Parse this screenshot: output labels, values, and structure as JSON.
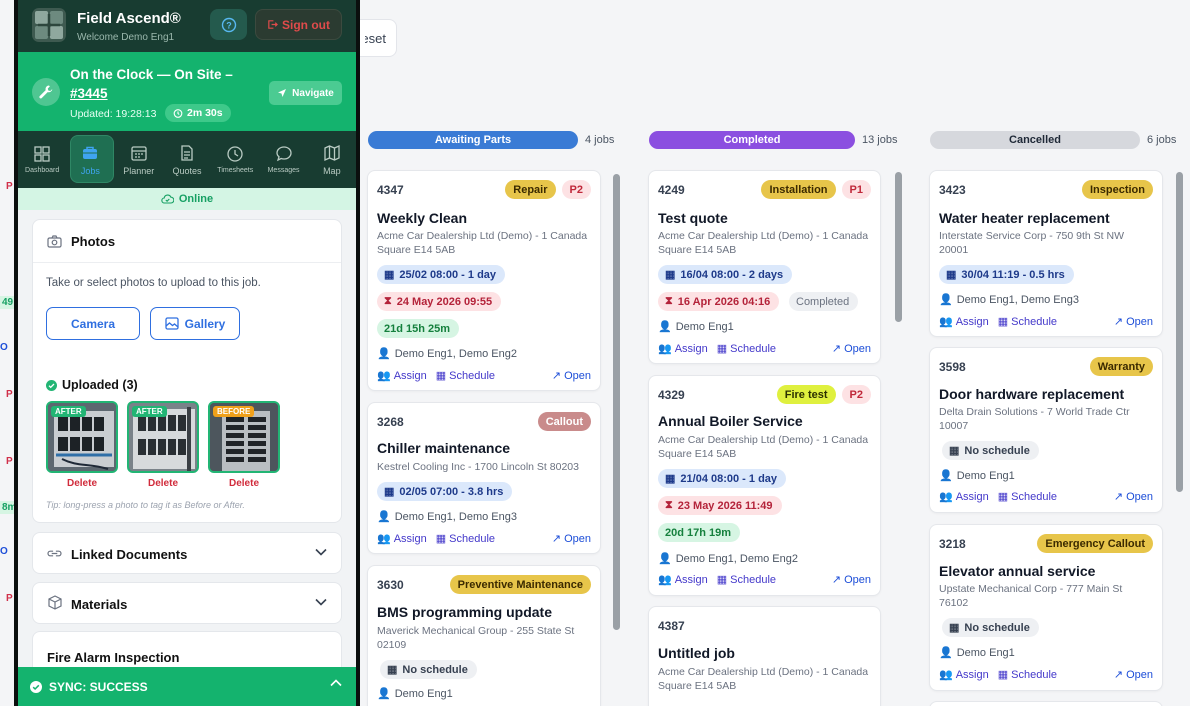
{
  "toolbar": {
    "reset_label": "Reset"
  },
  "ghost_column": {
    "fragments": [
      "P",
      "49",
      "O",
      "P",
      "P",
      "P",
      "8m",
      "O",
      "P",
      "P"
    ]
  },
  "columns": [
    {
      "name": "Awaiting Parts",
      "count": "4 jobs",
      "color": "#3a7bd5",
      "cards": [
        {
          "id": "4347",
          "tags": [
            "Repair",
            "P2"
          ],
          "title": "Weekly Clean",
          "address": "Acme Car Dealership Ltd (Demo) - 1 Canada Square E14 5AB",
          "date": "25/02 08:00 - 1 day",
          "due": "24 May 2026 09:55",
          "timer": "21d 15h 25m",
          "people": "Demo Eng1, Demo Eng2",
          "assign": "Assign",
          "schedule": "Schedule",
          "open": "Open"
        },
        {
          "id": "3268",
          "tags": [
            "Callout"
          ],
          "title": "Chiller maintenance",
          "address": "Kestrel Cooling Inc - 1700 Lincoln St 80203",
          "date": "02/05 07:00 - 3.8 hrs",
          "people": "Demo Eng1, Demo Eng3",
          "assign": "Assign",
          "schedule": "Schedule",
          "open": "Open"
        },
        {
          "id": "3630",
          "tags": [
            "Preventive Maintenance"
          ],
          "title": "BMS programming update",
          "address": "Maverick Mechanical Group - 255 State St 02109",
          "no_schedule": "No schedule",
          "people": "Demo Eng1"
        }
      ]
    },
    {
      "name": "Completed",
      "count": "13 jobs",
      "color": "#8b4fe0",
      "cards": [
        {
          "id": "4249",
          "tags": [
            "Installation",
            "P1"
          ],
          "title": "Test quote",
          "address": "Acme Car Dealership Ltd (Demo) - 1 Canada Square E14 5AB",
          "date": "16/04 08:00 - 2 days",
          "due": "16 Apr 2026 04:16",
          "status": "Completed",
          "people": "Demo Eng1",
          "assign": "Assign",
          "schedule": "Schedule",
          "open": "Open"
        },
        {
          "id": "4329",
          "tags": [
            "Fire test",
            "P2"
          ],
          "title": "Annual Boiler Service",
          "address": "Acme Car Dealership Ltd (Demo) - 1 Canada Square E14 5AB",
          "date": "21/04 08:00 - 1 day",
          "due": "23 May 2026 11:49",
          "timer": "20d 17h 19m",
          "people": "Demo Eng1, Demo Eng2",
          "assign": "Assign",
          "schedule": "Schedule",
          "open": "Open"
        },
        {
          "id": "4387",
          "title": "Untitled job",
          "address": "Acme Car Dealership Ltd (Demo) - 1 Canada Square E14 5AB"
        }
      ]
    },
    {
      "name": "Cancelled",
      "count": "6 jobs",
      "color": "#d6d8dd",
      "cards": [
        {
          "id": "3423",
          "tags": [
            "Inspection"
          ],
          "title": "Water heater replacement",
          "address": "Interstate Service Corp - 750 9th St NW 20001",
          "date": "30/04 11:19 - 0.5 hrs",
          "people": "Demo Eng1, Demo Eng3",
          "assign": "Assign",
          "schedule": "Schedule",
          "open": "Open"
        },
        {
          "id": "3598",
          "tags": [
            "Warranty"
          ],
          "title": "Door hardware replacement",
          "address": "Delta Drain Solutions - 7 World Trade Ctr 10007",
          "no_schedule": "No schedule",
          "people": "Demo Eng1",
          "assign": "Assign",
          "schedule": "Schedule",
          "open": "Open"
        },
        {
          "id": "3218",
          "tags": [
            "Emergency Callout"
          ],
          "title": "Elevator annual service",
          "address": "Upstate Mechanical Corp - 777 Main St 76102",
          "no_schedule": "No schedule",
          "people": "Demo Eng1",
          "assign": "Assign",
          "schedule": "Schedule",
          "open": "Open"
        }
      ]
    }
  ],
  "phone": {
    "app_title": "Field Ascend®",
    "welcome": "Welcome Demo Eng1",
    "sign_out": "Sign out",
    "banner": {
      "title_line": "On the Clock — On Site –",
      "job_ref": "#3445",
      "updated": "Updated: 19:28:13",
      "timer": "2m 30s",
      "navigate": "Navigate"
    },
    "nav": [
      {
        "label": "Dashboard",
        "icon": "grid-icon"
      },
      {
        "label": "Jobs",
        "icon": "briefcase-icon",
        "active": true
      },
      {
        "label": "Planner",
        "icon": "calendar-icon"
      },
      {
        "label": "Quotes",
        "icon": "document-icon"
      },
      {
        "label": "Timesheets",
        "icon": "clock-icon"
      },
      {
        "label": "Messages",
        "icon": "chat-icon"
      },
      {
        "label": "Map",
        "icon": "map-icon"
      }
    ],
    "status": "Online",
    "photos": {
      "title": "Photos",
      "hint": "Take or select photos to upload to this job.",
      "camera": "Camera",
      "gallery": "Gallery",
      "uploaded": "Uploaded (3)",
      "items": [
        {
          "badge": "AFTER",
          "delete": "Delete"
        },
        {
          "badge": "AFTER",
          "delete": "Delete"
        },
        {
          "badge": "BEFORE",
          "delete": "Delete"
        }
      ],
      "tip": "Tip: long-press a photo to tag it as Before or After."
    },
    "linked_documents": "Linked Documents",
    "materials": "Materials",
    "fire_alarm": "Fire Alarm Inspection",
    "sync": "SYNC: SUCCESS"
  }
}
